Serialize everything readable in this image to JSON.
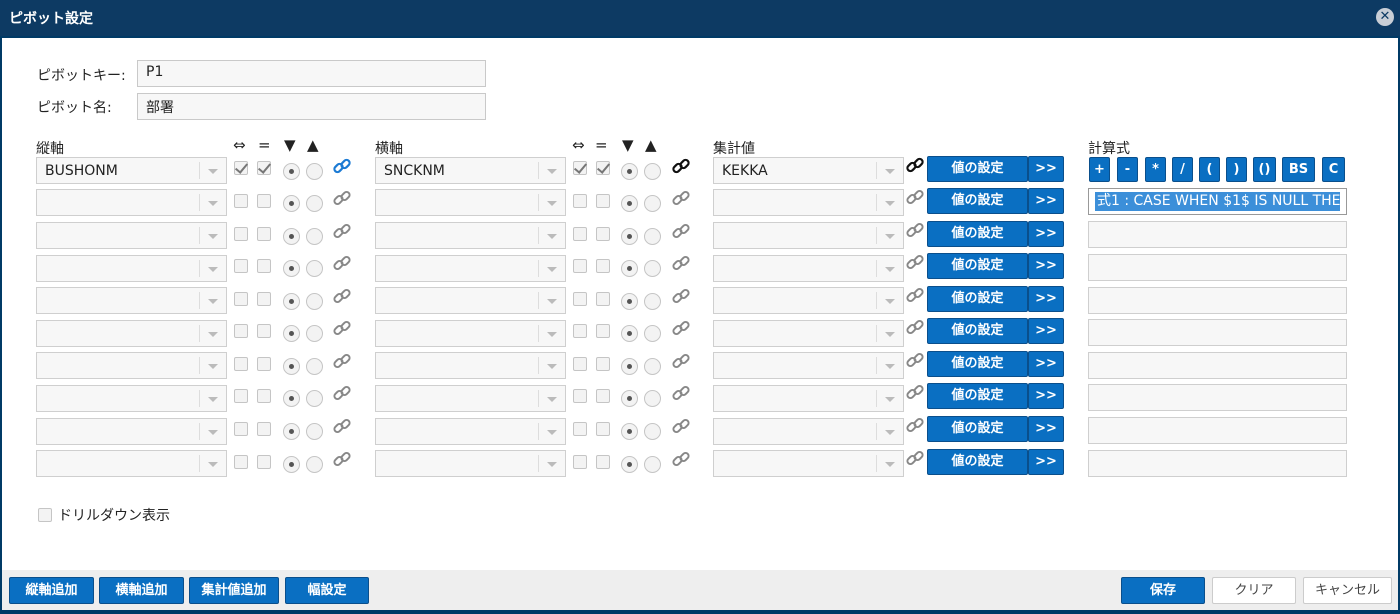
{
  "dialog": {
    "title": "ピボット設定",
    "close_symbol": "✕"
  },
  "fields": {
    "pivot_key_label": "ピボットキー:",
    "pivot_key_value": "P1",
    "pivot_name_label": "ピボット名:",
    "pivot_name_value": "部署"
  },
  "headers": {
    "vertical": "縦軸",
    "horizontal": "横軸",
    "aggregate": "集計値",
    "formula": "計算式",
    "swap_symbol": "⇔",
    "equal_symbol": "=",
    "desc_symbol": "▼",
    "asc_symbol": "▲"
  },
  "rows": [
    {
      "vertical": "BUSHONM",
      "horizontal": "SNCKNM",
      "aggregate": "KEKKA",
      "v_checks": [
        true,
        true
      ],
      "h_checks": [
        true,
        true
      ],
      "formula": ""
    },
    {
      "vertical": "",
      "horizontal": "",
      "aggregate": "",
      "v_checks": [
        false,
        false
      ],
      "h_checks": [
        false,
        false
      ],
      "formula": "式1 : CASE WHEN $1$ IS NULL THE"
    },
    {
      "vertical": "",
      "horizontal": "",
      "aggregate": "",
      "v_checks": [
        false,
        false
      ],
      "h_checks": [
        false,
        false
      ],
      "formula": ""
    },
    {
      "vertical": "",
      "horizontal": "",
      "aggregate": "",
      "v_checks": [
        false,
        false
      ],
      "h_checks": [
        false,
        false
      ],
      "formula": ""
    },
    {
      "vertical": "",
      "horizontal": "",
      "aggregate": "",
      "v_checks": [
        false,
        false
      ],
      "h_checks": [
        false,
        false
      ],
      "formula": ""
    },
    {
      "vertical": "",
      "horizontal": "",
      "aggregate": "",
      "v_checks": [
        false,
        false
      ],
      "h_checks": [
        false,
        false
      ],
      "formula": ""
    },
    {
      "vertical": "",
      "horizontal": "",
      "aggregate": "",
      "v_checks": [
        false,
        false
      ],
      "h_checks": [
        false,
        false
      ],
      "formula": ""
    },
    {
      "vertical": "",
      "horizontal": "",
      "aggregate": "",
      "v_checks": [
        false,
        false
      ],
      "h_checks": [
        false,
        false
      ],
      "formula": ""
    },
    {
      "vertical": "",
      "horizontal": "",
      "aggregate": "",
      "v_checks": [
        false,
        false
      ],
      "h_checks": [
        false,
        false
      ],
      "formula": ""
    },
    {
      "vertical": "",
      "horizontal": "",
      "aggregate": "",
      "v_checks": [
        false,
        false
      ],
      "h_checks": [
        false,
        false
      ],
      "formula": ""
    }
  ],
  "row_buttons": {
    "set_value": "値の設定",
    "more": ">>"
  },
  "calc_buttons": [
    "+",
    "-",
    "*",
    "/",
    "(",
    ")",
    "()",
    "BS",
    "C"
  ],
  "drilldown": {
    "label": "ドリルダウン表示",
    "checked": false
  },
  "footer": {
    "add_vertical": "縦軸追加",
    "add_horizontal": "横軸追加",
    "add_aggregate": "集計値追加",
    "width_settings": "幅設定",
    "save": "保存",
    "clear": "クリア",
    "cancel": "キャンセル"
  },
  "colors": {
    "title_bg": "#0d3a63",
    "button_blue": "#0a6fc2",
    "selection": "#3c8fd9"
  }
}
